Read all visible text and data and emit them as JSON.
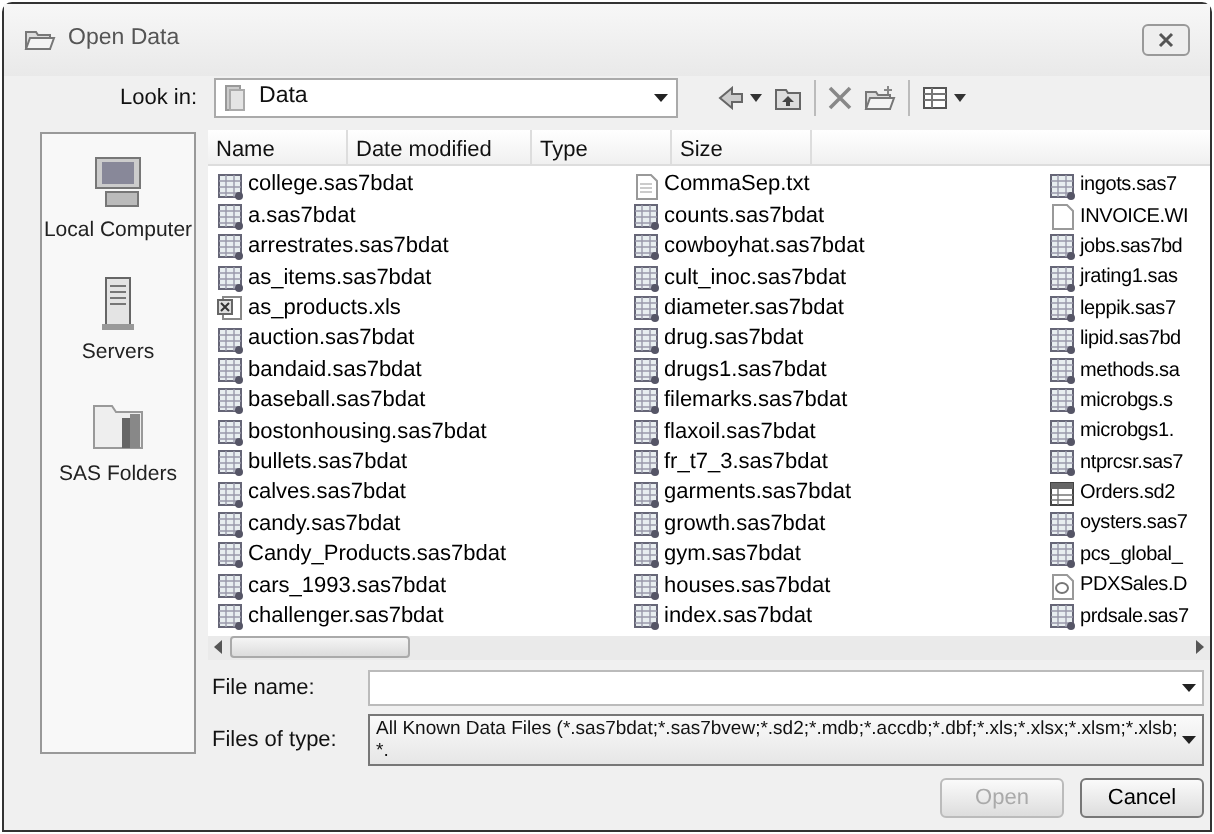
{
  "window": {
    "title": "Open Data"
  },
  "look_in": {
    "label": "Look in:",
    "value": "Data"
  },
  "places": [
    {
      "label": "Local Computer",
      "kind": "computer"
    },
    {
      "label": "Servers",
      "kind": "server"
    },
    {
      "label": "SAS Folders",
      "kind": "folder"
    }
  ],
  "columns": [
    "Name",
    "Date modified",
    "Type",
    "Size"
  ],
  "file_columns": [
    {
      "files": [
        {
          "name": "college.sas7bdat",
          "kind": "dataset"
        },
        {
          "name": "a.sas7bdat",
          "kind": "dataset"
        },
        {
          "name": "arrestrates.sas7bdat",
          "kind": "dataset"
        },
        {
          "name": "as_items.sas7bdat",
          "kind": "dataset"
        },
        {
          "name": "as_products.xls",
          "kind": "excel"
        },
        {
          "name": "auction.sas7bdat",
          "kind": "dataset"
        },
        {
          "name": "bandaid.sas7bdat",
          "kind": "dataset"
        },
        {
          "name": "baseball.sas7bdat",
          "kind": "dataset"
        },
        {
          "name": "bostonhousing.sas7bdat",
          "kind": "dataset"
        },
        {
          "name": "bullets.sas7bdat",
          "kind": "dataset"
        },
        {
          "name": "calves.sas7bdat",
          "kind": "dataset"
        },
        {
          "name": "candy.sas7bdat",
          "kind": "dataset"
        },
        {
          "name": "Candy_Products.sas7bdat",
          "kind": "dataset"
        },
        {
          "name": "cars_1993.sas7bdat",
          "kind": "dataset"
        },
        {
          "name": "challenger.sas7bdat",
          "kind": "dataset"
        }
      ]
    },
    {
      "files": [
        {
          "name": "CommaSep.txt",
          "kind": "text"
        },
        {
          "name": "counts.sas7bdat",
          "kind": "dataset"
        },
        {
          "name": "cowboyhat.sas7bdat",
          "kind": "dataset"
        },
        {
          "name": "cult_inoc.sas7bdat",
          "kind": "dataset"
        },
        {
          "name": "diameter.sas7bdat",
          "kind": "dataset"
        },
        {
          "name": "drug.sas7bdat",
          "kind": "dataset"
        },
        {
          "name": "drugs1.sas7bdat",
          "kind": "dataset"
        },
        {
          "name": "filemarks.sas7bdat",
          "kind": "dataset"
        },
        {
          "name": "flaxoil.sas7bdat",
          "kind": "dataset"
        },
        {
          "name": "fr_t7_3.sas7bdat",
          "kind": "dataset"
        },
        {
          "name": "garments.sas7bdat",
          "kind": "dataset"
        },
        {
          "name": "growth.sas7bdat",
          "kind": "dataset"
        },
        {
          "name": "gym.sas7bdat",
          "kind": "dataset"
        },
        {
          "name": "houses.sas7bdat",
          "kind": "dataset"
        },
        {
          "name": "index.sas7bdat",
          "kind": "dataset"
        }
      ]
    },
    {
      "files": [
        {
          "name": "ingots.sas7",
          "kind": "dataset"
        },
        {
          "name": "INVOICE.WI",
          "kind": "blank"
        },
        {
          "name": "jobs.sas7bd",
          "kind": "dataset"
        },
        {
          "name": "jrating1.sas",
          "kind": "dataset"
        },
        {
          "name": "leppik.sas7",
          "kind": "dataset"
        },
        {
          "name": "lipid.sas7bd",
          "kind": "dataset"
        },
        {
          "name": "methods.sa",
          "kind": "dataset"
        },
        {
          "name": "microbgs.s",
          "kind": "dataset"
        },
        {
          "name": "microbgs1.",
          "kind": "dataset"
        },
        {
          "name": "ntprcsr.sas7",
          "kind": "dataset"
        },
        {
          "name": "Orders.sd2",
          "kind": "sd2"
        },
        {
          "name": "oysters.sas7",
          "kind": "dataset"
        },
        {
          "name": "pcs_global_",
          "kind": "dataset"
        },
        {
          "name": "PDXSales.D",
          "kind": "database"
        },
        {
          "name": "prdsale.sas7",
          "kind": "dataset"
        }
      ]
    }
  ],
  "file_name": {
    "label": "File name:"
  },
  "files_of_type": {
    "label": "Files of type:",
    "value": "All Known Data Files (*.sas7bdat;*.sas7bvew;*.sd2;*.mdb;*.accdb;*.dbf;*.xls;*.xlsx;*.xlsm;*.xlsb;*."
  },
  "buttons": [
    {
      "label": "Open",
      "disabled": true
    },
    {
      "label": "Cancel",
      "disabled": false
    }
  ]
}
